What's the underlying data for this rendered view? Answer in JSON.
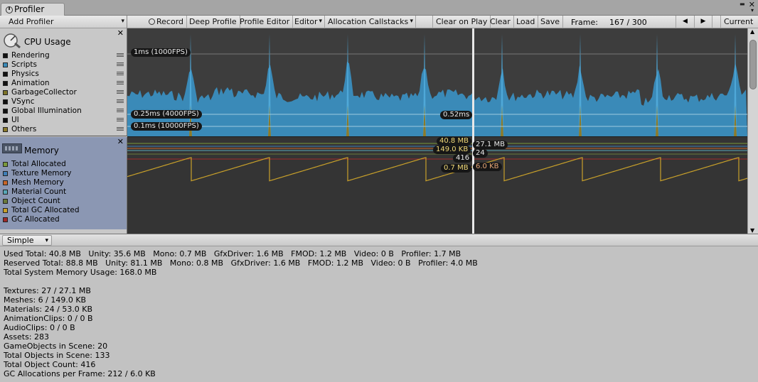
{
  "window": {
    "tab_title": "Profiler"
  },
  "toolbar": {
    "add_profiler": "Add Profiler",
    "record": "Record",
    "deep_profile": "Deep Profile",
    "profile_editor": "Profile Editor",
    "editor": "Editor",
    "allocation_callstacks": "Allocation Callstacks",
    "clear_on_play": "Clear on Play",
    "clear": "Clear",
    "load": "Load",
    "save": "Save",
    "frame_label": "Frame:",
    "frame_value": "167 / 300",
    "prev_icon": "◀",
    "next_icon": "▶",
    "current": "Current"
  },
  "cpu_panel": {
    "title": "CPU Usage",
    "items": [
      {
        "label": "Rendering",
        "color": "#111111"
      },
      {
        "label": "Scripts",
        "color": "#3a8ab8"
      },
      {
        "label": "Physics",
        "color": "#111111"
      },
      {
        "label": "Animation",
        "color": "#111111"
      },
      {
        "label": "GarbageCollector",
        "color": "#7d7428"
      },
      {
        "label": "VSync",
        "color": "#111111"
      },
      {
        "label": "Global Illumination",
        "color": "#111111"
      },
      {
        "label": "UI",
        "color": "#111111"
      },
      {
        "label": "Others",
        "color": "#8b7a2a"
      }
    ],
    "labels": {
      "fps1000": "1ms (1000FPS)",
      "fps4000": "0.25ms (4000FPS)",
      "fps10000": "0.1ms (10000FPS)",
      "selected": "0.52ms"
    }
  },
  "memory_panel": {
    "title": "Memory",
    "items": [
      {
        "label": "Total Allocated",
        "color": "#7a9a3a"
      },
      {
        "label": "Texture Memory",
        "color": "#3f7fb8"
      },
      {
        "label": "Mesh Memory",
        "color": "#c8662a"
      },
      {
        "label": "Material Count",
        "color": "#58a8b8"
      },
      {
        "label": "Object Count",
        "color": "#6a7a3a"
      },
      {
        "label": "Total GC Allocated",
        "color": "#c8a02a"
      },
      {
        "label": "GC Allocated",
        "color": "#a02a2a"
      }
    ],
    "labels": {
      "total_allocated": "40.8 MB",
      "texture": "27.1 MB",
      "mesh": "149.0 KB",
      "material": "24",
      "object": "416",
      "total_gc": "0.7 MB",
      "gc": "6.0 KB"
    }
  },
  "bottom": {
    "mode": "Simple",
    "lines": [
      "Used Total: 40.8 MB   Unity: 35.6 MB   Mono: 0.7 MB   GfxDriver: 1.6 MB   FMOD: 1.2 MB   Video: 0 B   Profiler: 1.7 MB",
      "Reserved Total: 88.8 MB   Unity: 81.1 MB   Mono: 0.8 MB   GfxDriver: 1.6 MB   FMOD: 1.2 MB   Video: 0 B   Profiler: 4.0 MB",
      "Total System Memory Usage: 168.0 MB",
      "",
      "Textures: 27 / 27.1 MB",
      "Meshes: 6 / 149.0 KB",
      "Materials: 24 / 53.0 KB",
      "AnimationClips: 0 / 0 B",
      "AudioClips: 0 / 0 B",
      "Assets: 283",
      "GameObjects in Scene: 20",
      "Total Objects in Scene: 133",
      "Total Object Count: 416",
      "GC Allocations per Frame: 212 / 6.0 KB"
    ]
  }
}
